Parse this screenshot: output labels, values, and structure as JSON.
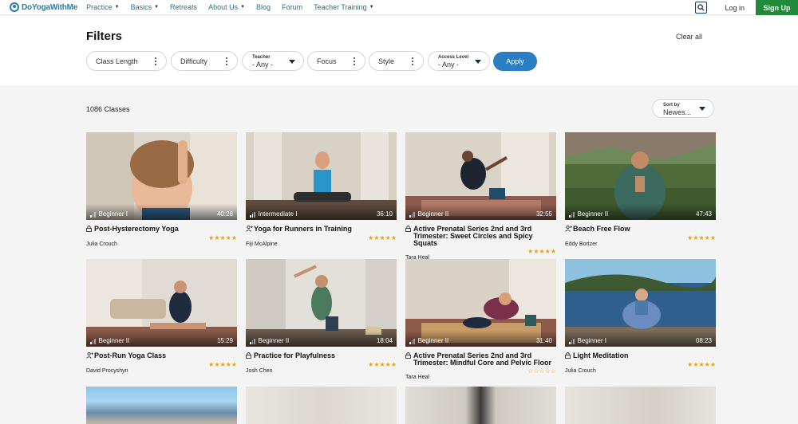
{
  "nav": {
    "logo_text": "DoYogaWithMe",
    "items": [
      {
        "label": "Practice",
        "dropdown": true
      },
      {
        "label": "Basics",
        "dropdown": true
      },
      {
        "label": "Retreats",
        "dropdown": false
      },
      {
        "label": "About Us",
        "dropdown": true
      },
      {
        "label": "Blog",
        "dropdown": false
      },
      {
        "label": "Forum",
        "dropdown": false
      },
      {
        "label": "Teacher Training",
        "dropdown": true
      }
    ],
    "login": "Log in",
    "signup": "Sign Up",
    "caret": "▼"
  },
  "filters": {
    "title": "Filters",
    "clear_all": "Clear all",
    "class_length": "Class Length",
    "difficulty": "Difficulty",
    "teacher_label": "Teacher",
    "teacher_value": "- Any -",
    "focus": "Focus",
    "style": "Style",
    "access_label": "Access Level",
    "access_value": "- Any -",
    "apply": "Apply"
  },
  "results": {
    "count": "1086 Classes",
    "sort_label": "Sort by",
    "sort_value": "Newes..."
  },
  "colors": {
    "brand": "#2b7ea1",
    "signup": "#1e8a3a",
    "apply": "#2b7ec1",
    "stars": "#e8a317"
  },
  "cards": [
    {
      "level": "Beginner I",
      "duration": "40:28",
      "title": "Post-Hysterectomy Yoga",
      "title2": "",
      "teacher": "Julia Crouch",
      "icon": "lock-icon",
      "icon_glyph": "🔒",
      "stars": "★★★★★",
      "rating": 5
    },
    {
      "level": "Intermediate I",
      "duration": "36:10",
      "title": "Yoga for Runners in Training",
      "title2": "",
      "teacher": "Fiji McAlpine",
      "icon": "person-plus-icon",
      "icon_glyph": "👤",
      "stars": "★★★★★",
      "rating": 5
    },
    {
      "level": "Beginner II",
      "duration": "32:55",
      "title": "Active Prenatal Series 2nd and 3rd",
      "title2": "Trimester: Sweet Circles and Spicy Squats",
      "teacher": "Tara Heal",
      "icon": "lock-icon",
      "icon_glyph": "🔒",
      "stars": "★★★★★",
      "rating": 5
    },
    {
      "level": "Beginner II",
      "duration": "47:43",
      "title": "Beach Free Flow",
      "title2": "",
      "teacher": "Eddy Bortzer",
      "icon": "person-plus-icon",
      "icon_glyph": "👤",
      "stars": "★★★★★",
      "rating": 5
    },
    {
      "level": "Beginner II",
      "duration": "15:29",
      "title": "Post-Run Yoga Class",
      "title2": "",
      "teacher": "David Procyshyn",
      "icon": "person-plus-icon",
      "icon_glyph": "👤",
      "stars": "★★★★★",
      "rating": 5
    },
    {
      "level": "Beginner II",
      "duration": "18:04",
      "title": "Practice for Playfulness",
      "title2": "",
      "teacher": "Josh Chen",
      "icon": "lock-icon",
      "icon_glyph": "🔒",
      "stars": "★★★★★",
      "rating": 5
    },
    {
      "level": "Beginner II",
      "duration": "31:40",
      "title": "Active Prenatal Series 2nd and 3rd",
      "title2": "Trimester: Mindful Core and Pelvic Floor",
      "teacher": "Tara Heal",
      "icon": "lock-icon",
      "icon_glyph": "🔒",
      "stars": "☆☆☆☆☆",
      "rating": 0
    },
    {
      "level": "Beginner I",
      "duration": "08:23",
      "title": "Light Meditation",
      "title2": "",
      "teacher": "Julia Crouch",
      "icon": "lock-icon",
      "icon_glyph": "🔒",
      "stars": "★★★★★",
      "rating": 5
    }
  ]
}
